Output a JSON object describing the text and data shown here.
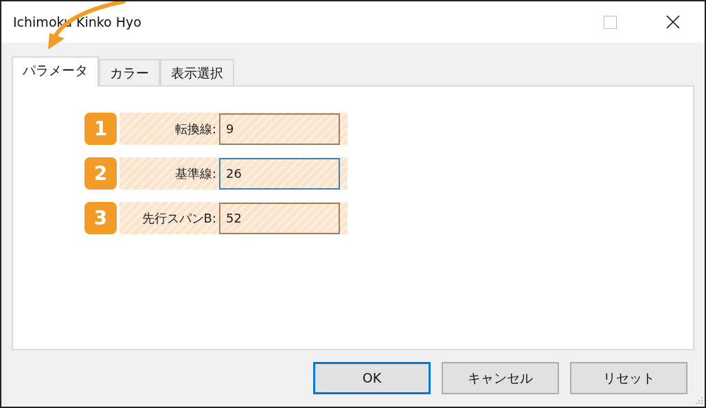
{
  "window": {
    "title": "Ichimoku Kinko Hyo"
  },
  "tabs": [
    {
      "label": "パラメータ",
      "selected": true
    },
    {
      "label": "カラー",
      "selected": false
    },
    {
      "label": "表示選択",
      "selected": false
    }
  ],
  "parameters": [
    {
      "number": "1",
      "label": "転換線:",
      "value": "9",
      "focused": false
    },
    {
      "number": "2",
      "label": "基準線:",
      "value": "26",
      "focused": true
    },
    {
      "number": "3",
      "label": "先行スパンB:",
      "value": "52",
      "focused": false
    }
  ],
  "buttons": [
    {
      "label": "OK",
      "default": true
    },
    {
      "label": "キャンセル",
      "default": false
    },
    {
      "label": "リセット",
      "default": false
    }
  ]
}
